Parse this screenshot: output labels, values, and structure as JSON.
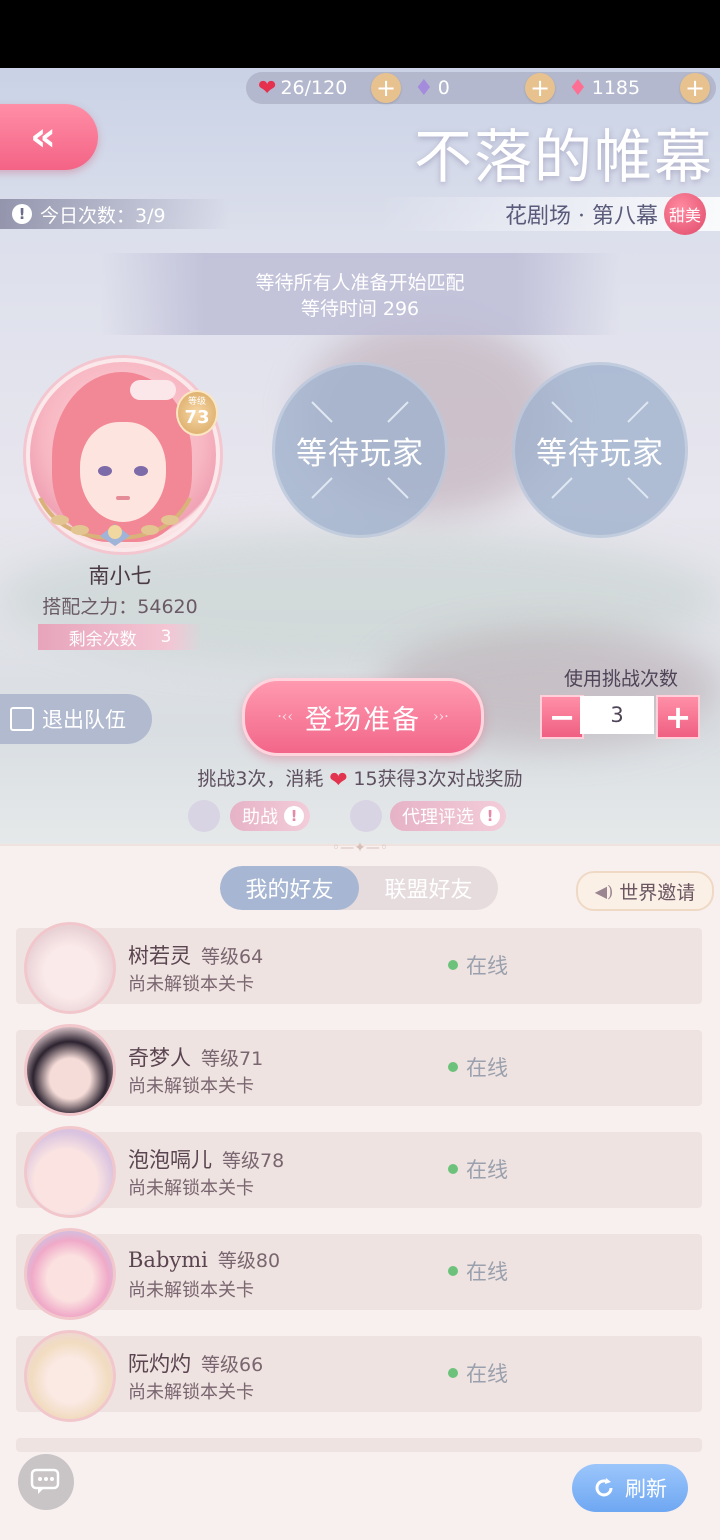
{
  "currency": {
    "stamina": "26/120",
    "diamond_purple": "0",
    "diamond_pink": "1185",
    "plus_label": "+"
  },
  "header": {
    "back_label": "«",
    "title": "不落的帷幕",
    "today_count": "今日次数：3/9",
    "stage": "花剧场 · 第八幕",
    "style_badge": "甜美"
  },
  "matching": {
    "line1": "等待所有人准备开始匹配",
    "line2": "等待时间 296"
  },
  "player": {
    "level_label": "等级",
    "level": "73",
    "name": "南小七",
    "power": "搭配之力：54620",
    "remain_label": "剩余次数",
    "remain_value": "3"
  },
  "slots": [
    "等待玩家",
    "等待玩家"
  ],
  "controls": {
    "exit_label": "退出队伍",
    "ready_label": "登场准备",
    "use_label": "使用挑战次数",
    "minus": "−",
    "plus": "+",
    "count": "3",
    "cost_before": "挑战3次，消耗",
    "cost_after": "15获得3次对战奖励",
    "assist_label": "助战",
    "agent_label": "代理评选"
  },
  "friends": {
    "tabs": [
      "我的好友",
      "联盟好友"
    ],
    "invite_label": "世界邀请",
    "list": [
      {
        "name": "树若灵",
        "level": "等级64",
        "status": "尚未解锁本关卡",
        "online": "在线"
      },
      {
        "name": "奇梦人",
        "level": "等级71",
        "status": "尚未解锁本关卡",
        "online": "在线"
      },
      {
        "name": "泡泡嗝儿",
        "level": "等级78",
        "status": "尚未解锁本关卡",
        "online": "在线"
      },
      {
        "name": "Babymi",
        "level": "等级80",
        "status": "尚未解锁本关卡",
        "online": "在线"
      },
      {
        "name": "阮灼灼",
        "level": "等级66",
        "status": "尚未解锁本关卡",
        "online": "在线"
      }
    ],
    "refresh_label": "刷新"
  },
  "colors": {
    "accent_pink": "#f2668a",
    "slot_blue": "#a0b2cd",
    "online_green": "#6cc27b"
  }
}
